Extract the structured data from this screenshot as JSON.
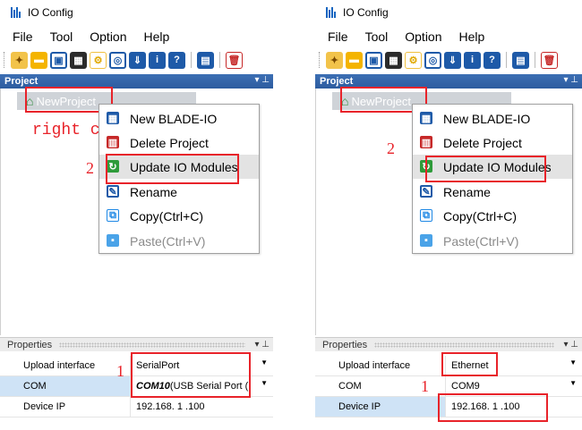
{
  "colors": {
    "accent": "#e8232a",
    "header": "#2d5c9f",
    "selection": "#cfe3f6"
  },
  "title": "IO Config",
  "menus": [
    "File",
    "Tool",
    "Option",
    "Help"
  ],
  "project_header": "Project",
  "project_header_ctrl": "▾ ⊥",
  "tree_node": "NewProject",
  "context_menu": [
    {
      "label": "New BLADE-IO",
      "icon": "blade-io-icon"
    },
    {
      "label": "Delete Project",
      "icon": "trash-icon"
    },
    {
      "label": "Update IO Modules",
      "icon": "update-modules-icon"
    },
    {
      "label": "Rename",
      "icon": "rename-icon"
    },
    {
      "label": "Copy(Ctrl+C)",
      "icon": "copy-icon"
    },
    {
      "label": "Paste(Ctrl+V)",
      "icon": "paste-icon"
    }
  ],
  "properties_header": "Properties",
  "prop_labels": [
    "Upload interface",
    "COM",
    "Device IP"
  ],
  "left": {
    "annotation": "right click",
    "num_menu": "2",
    "num_prop": "1",
    "upload_interface": "SerialPort",
    "com_bold": "COM10",
    "com_rest": " (USB Serial Port (",
    "device_ip": "192.168. 1 .100"
  },
  "right": {
    "num_menu": "2",
    "num_prop": "1",
    "upload_interface": "Ethernet",
    "com": "COM9",
    "device_ip": "192.168. 1 .100"
  }
}
